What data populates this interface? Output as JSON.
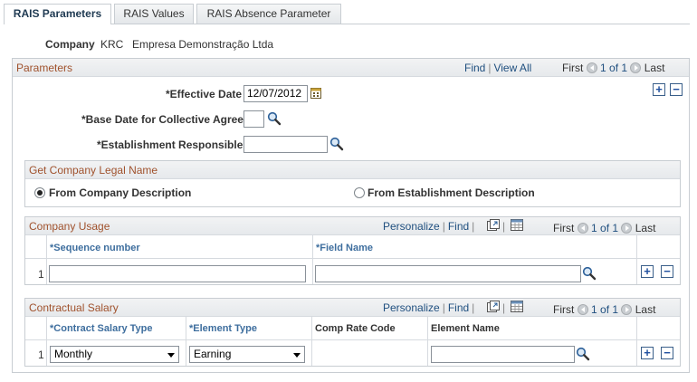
{
  "tabs": [
    "RAIS Parameters",
    "RAIS Values",
    "RAIS Absence Parameter"
  ],
  "company": {
    "label": "Company",
    "code": "KRC",
    "name": "Empresa Demonstração Ltda"
  },
  "parameters": {
    "title": "Parameters",
    "find": "Find",
    "view_all": "View All",
    "first": "First",
    "count": "1 of 1",
    "last": "Last",
    "effective_date_label": "*Effective Date",
    "effective_date_value": "12/07/2012",
    "base_date_label": "*Base Date for Collective Agree",
    "establishment_label": "*Establishment Responsible"
  },
  "legal_name": {
    "title": "Get Company Legal Name",
    "option1": "From Company Description",
    "option2": "From Establishment Description",
    "selected": "option1"
  },
  "company_usage": {
    "title": "Company Usage",
    "personalize": "Personalize",
    "find": "Find",
    "first": "First",
    "count": "1 of 1",
    "last": "Last",
    "col_seq": "*Sequence number",
    "col_field": "*Field Name",
    "row_num": "1"
  },
  "contractual_salary": {
    "title": "Contractual Salary",
    "personalize": "Personalize",
    "find": "Find",
    "first": "First",
    "count": "1 of 1",
    "last": "Last",
    "col_type": "*Contract Salary Type",
    "col_element_type": "*Element Type",
    "col_comp_rate": "Comp Rate Code",
    "col_element_name": "Element Name",
    "row_num": "1",
    "salary_type_value": "Monthly",
    "element_type_value": "Earning"
  },
  "icons": {
    "add": "+",
    "remove": "−"
  },
  "colors": {
    "section_title": "#a0522d",
    "link": "#1f4f7f",
    "column_header": "#3e6e9e"
  }
}
